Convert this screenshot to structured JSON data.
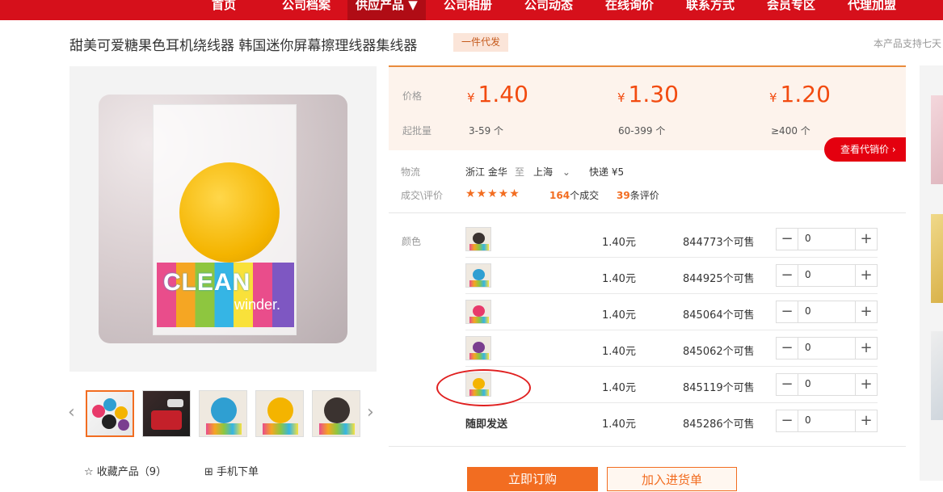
{
  "nav": {
    "items": [
      "首页",
      "公司档案",
      "供应产品 ▼",
      "公司相册",
      "公司动态",
      "在线询价",
      "联系方式",
      "会员专区",
      "代理加盟"
    ],
    "active_index": 2,
    "brand_color": "#d6101b"
  },
  "product": {
    "title": "甜美可爱糖果色耳机绕线器 韩国迷你屏幕擦理线器集线器",
    "badge": "一件代发",
    "support_text": "本产品支持七天"
  },
  "gallery": {
    "main_image_text": {
      "line1": "CLEAN",
      "line2": "winder."
    },
    "thumbnail_icons": [
      "thumb-colorful-discs",
      "thumb-phone-cable",
      "thumb-blue-disc",
      "thumb-yellow-disc",
      "thumb-black-disc"
    ],
    "prev_arrow": "‹",
    "next_arrow": "›",
    "favorite_label": "收藏产品（9）",
    "favorite_icon": "☆",
    "mobile_order_label": "手机下单",
    "qr_icon": "⊞"
  },
  "pricing": {
    "price_label": "价格",
    "moq_label": "起批量",
    "currency": "¥",
    "tiers": [
      {
        "price": "1.40",
        "range": "3-59 个"
      },
      {
        "price": "1.30",
        "range": "60-399 个"
      },
      {
        "price": "1.20",
        "range": "≥400 个"
      }
    ],
    "agent_price_button": "查看代销价 ›",
    "accent": "#f24b10"
  },
  "logistics": {
    "label": "物流",
    "from": "浙江 金华",
    "to_word": "至",
    "to": "上海",
    "dropdown_icon": "⌄",
    "shipping": "快递 ¥5"
  },
  "reviews": {
    "label": "成交\\评价",
    "stars": "★★★★★",
    "rating": 4.5,
    "deals_count": "164",
    "deals_label": "个成交",
    "review_count": "39",
    "review_label": "条评价"
  },
  "variants": {
    "label": "颜色",
    "rows": [
      {
        "color_name": "",
        "dot_color": "#3b3330",
        "price": "1.40元",
        "stock": "844773个可售",
        "qty": "0"
      },
      {
        "color_name": "",
        "dot_color": "#2f9fd2",
        "price": "1.40元",
        "stock": "844925个可售",
        "qty": "0"
      },
      {
        "color_name": "",
        "dot_color": "#e83a6a",
        "price": "1.40元",
        "stock": "845064个可售",
        "qty": "0"
      },
      {
        "color_name": "",
        "dot_color": "#7a3e8f",
        "price": "1.40元",
        "stock": "845062个可售",
        "qty": "0"
      },
      {
        "color_name": "",
        "dot_color": "#f4b400",
        "price": "1.40元",
        "stock": "845119个可售",
        "qty": "0"
      },
      {
        "color_name": "随即发送",
        "dot_color": "",
        "price": "1.40元",
        "stock": "845286个可售",
        "qty": "0"
      }
    ],
    "minus": "−",
    "plus": "+"
  },
  "actions": {
    "buy_now": "立即订购",
    "add_cart": "加入进货单"
  }
}
